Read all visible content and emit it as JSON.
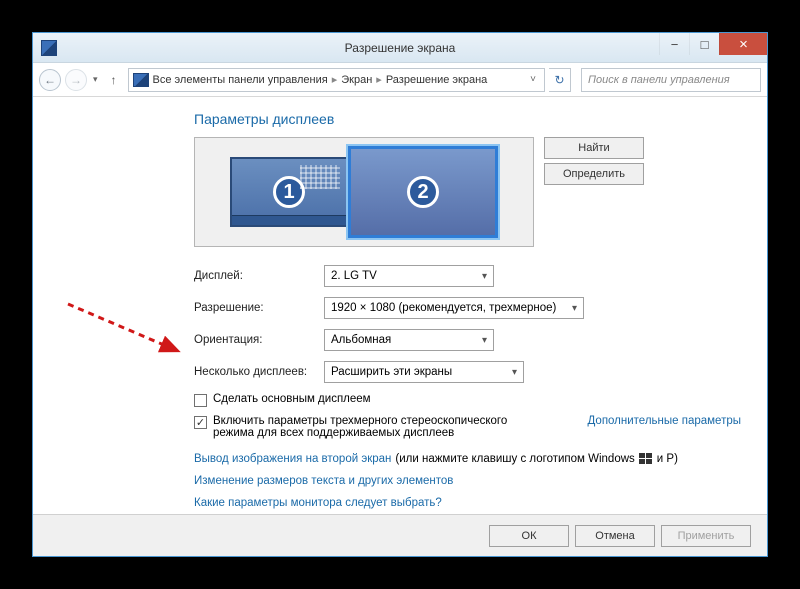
{
  "window": {
    "title": "Разрешение экрана",
    "minimize": "−",
    "maximize": "□",
    "close": "×"
  },
  "nav": {
    "back": "←",
    "forward": "→",
    "up": "↑",
    "refresh": "↻",
    "breadcrumb": {
      "item1": "Все элементы панели управления",
      "item2": "Экран",
      "item3": "Разрешение экрана"
    },
    "search_placeholder": "Поиск в панели управления"
  },
  "heading": "Параметры дисплеев",
  "preview": {
    "monitor1_num": "1",
    "monitor2_num": "2"
  },
  "buttons": {
    "find": "Найти",
    "identify": "Определить",
    "ok": "ОК",
    "cancel": "Отмена",
    "apply": "Применить"
  },
  "labels": {
    "display": "Дисплей:",
    "resolution": "Разрешение:",
    "orientation": "Ориентация:",
    "multi": "Несколько дисплеев:"
  },
  "values": {
    "display": "2. LG TV",
    "resolution": "1920 × 1080 (рекомендуется, трехмерное)",
    "orientation": "Альбомная",
    "multi": "Расширить эти экраны"
  },
  "checkboxes": {
    "make_primary": "Сделать основным дисплеем",
    "stereo": "Включить параметры трехмерного стереоскопического режима для всех поддерживаемых дисплеев"
  },
  "links": {
    "advanced": "Дополнительные параметры",
    "second_screen_prefix": "Вывод изображения на второй экран",
    "second_screen_suffix": "(или нажмите клавишу с логотипом Windows",
    "second_screen_tail": "и P)",
    "text_size": "Изменение размеров текста и других элементов",
    "which_monitor": "Какие параметры монитора следует выбрать?"
  }
}
